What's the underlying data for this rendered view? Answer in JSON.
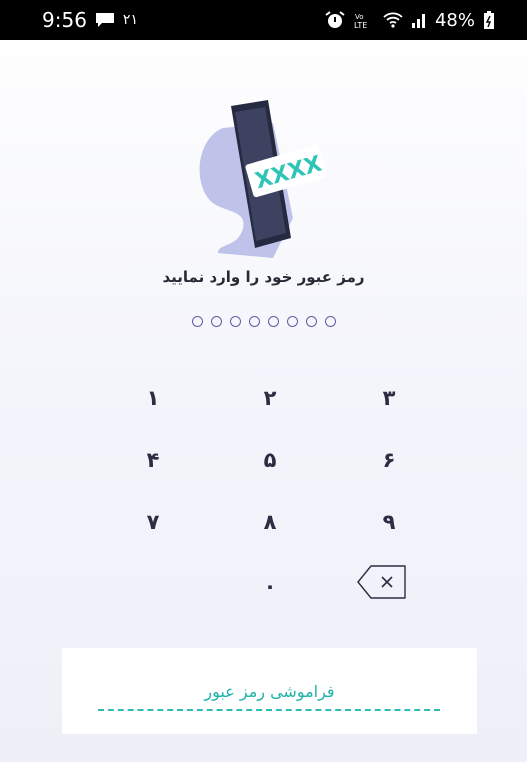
{
  "status_bar": {
    "time": "9:56",
    "notification_count": "۲۱",
    "battery_percent": "48%",
    "network_label": "LTE",
    "icons": [
      "chat-icon",
      "alarm-icon",
      "volte-icon",
      "wifi-icon",
      "signal-icon",
      "battery-icon"
    ]
  },
  "illustration": {
    "code_text": "XXXX",
    "colors": {
      "phone": "#3c4260",
      "blob": "#b8bde8",
      "card": "#ffffff",
      "code": "#2ec4b6"
    }
  },
  "login": {
    "prompt": "رمز عبور خود را وارد نمایید",
    "pin_length": 8,
    "pin_filled": 0
  },
  "keypad": {
    "keys": [
      "۱",
      "۲",
      "۳",
      "۴",
      "۵",
      "۶",
      "۷",
      "۸",
      "۹",
      "۰"
    ],
    "backspace_icon": "backspace-icon"
  },
  "forgot": {
    "label": "فراموشی رمز عبور",
    "color": "#20b3a8"
  }
}
